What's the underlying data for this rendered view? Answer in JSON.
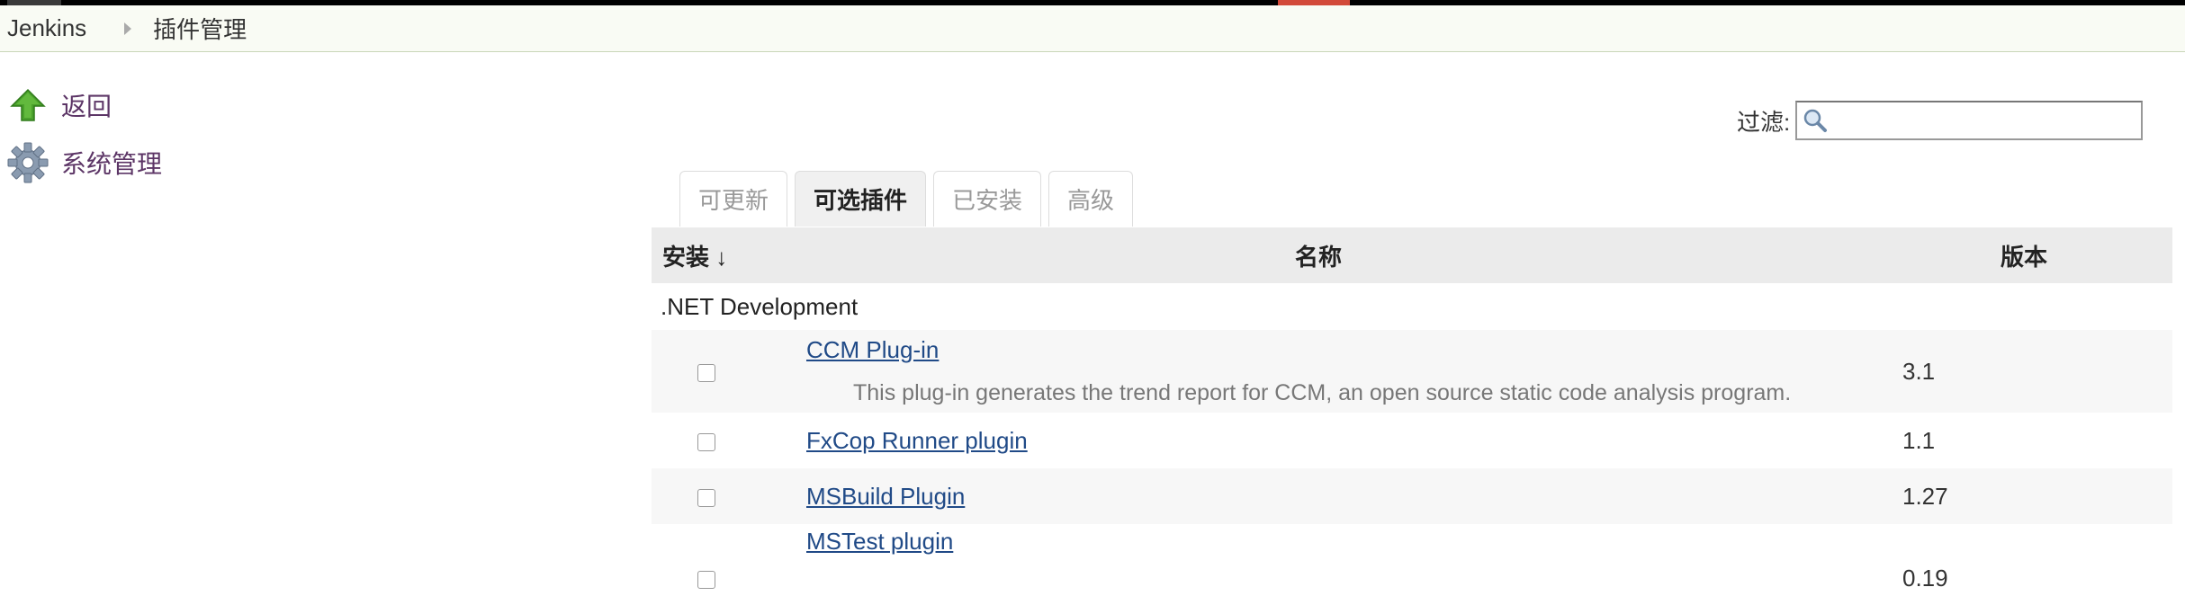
{
  "breadcrumb": {
    "root": "Jenkins",
    "current": "插件管理"
  },
  "tasks": [
    {
      "label": "返回",
      "icon": "up-arrow-icon"
    },
    {
      "label": "系统管理",
      "icon": "gear-icon"
    }
  ],
  "filter": {
    "label": "过滤:",
    "value": "",
    "icon": "search-icon"
  },
  "tabs": [
    {
      "label": "可更新",
      "active": false
    },
    {
      "label": "可选插件",
      "active": true
    },
    {
      "label": "已安装",
      "active": false
    },
    {
      "label": "高级",
      "active": false
    }
  ],
  "table": {
    "headers": {
      "install": "安装 ↓",
      "name": "名称",
      "version": "版本"
    },
    "category": ".NET Development",
    "plugins": [
      {
        "name": "CCM Plug-in",
        "description": "This plug-in generates the trend report for CCM, an open source static code analysis program.",
        "version": "3.1"
      },
      {
        "name": "FxCop Runner plugin",
        "description": "",
        "version": "1.1"
      },
      {
        "name": "MSBuild Plugin",
        "description": "",
        "version": "1.27"
      },
      {
        "name": "MSTest plugin",
        "description": "",
        "version": "0.19"
      }
    ]
  },
  "colors": {
    "link": "#204a87",
    "task_link": "#5c3566",
    "header_bg": "#ebebeb",
    "breadcrumb_bg": "#f9fbf4"
  }
}
